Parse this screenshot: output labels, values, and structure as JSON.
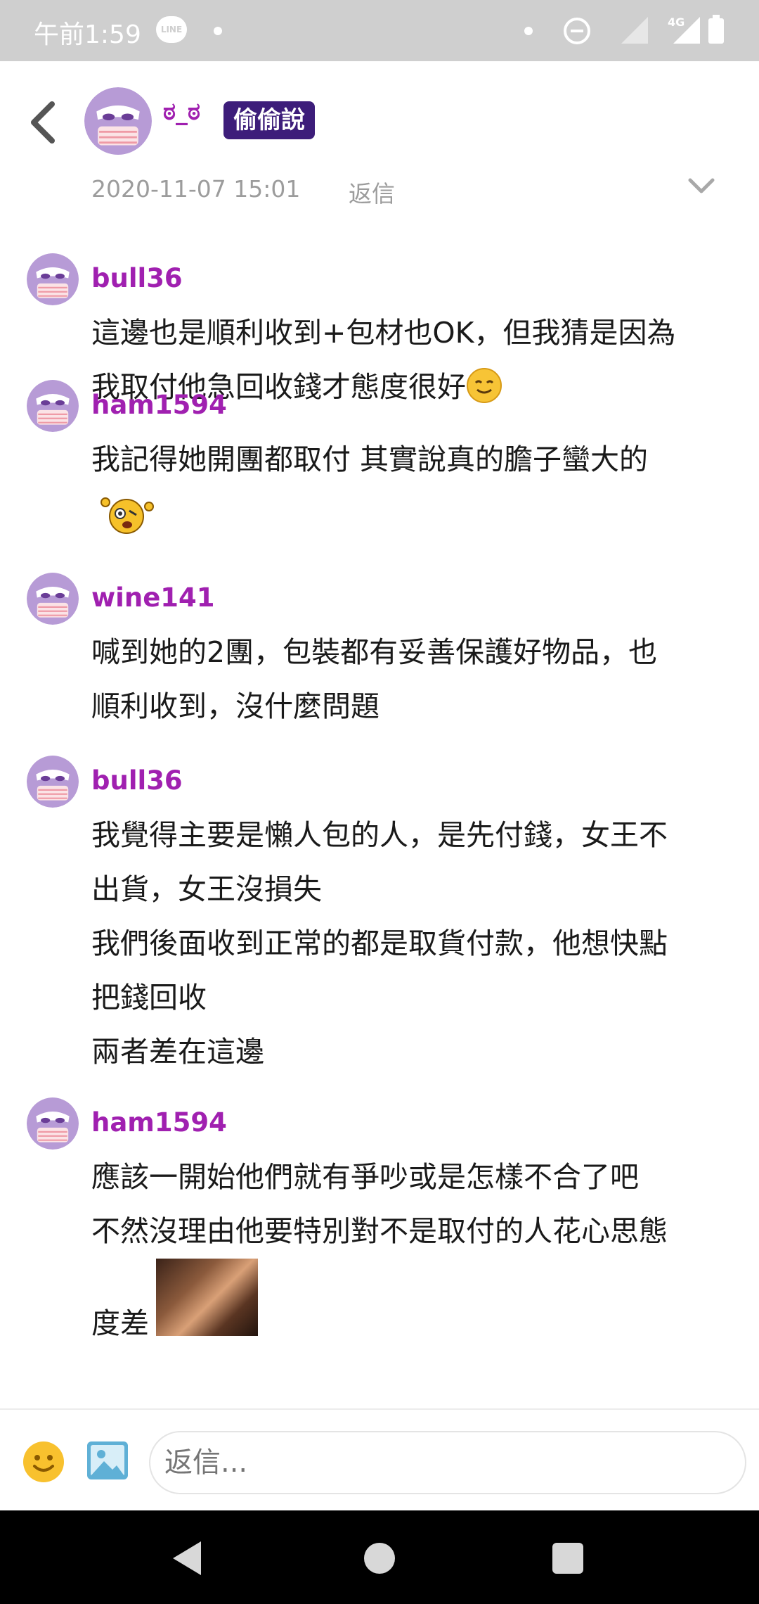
{
  "status_bar": {
    "time": "午前1:59",
    "line_badge": "LINE",
    "network": "4G"
  },
  "header": {
    "user_name": "ಠ_ಠ",
    "tag": "偷偷說",
    "date": "2020-11-07 15:01",
    "reply_label": "返信"
  },
  "comments": [
    {
      "user": "bull36",
      "line1": "這邊也是順利收到+包材也OK，但我猜是因為",
      "line2": "我取付他急回收錢才態度很好",
      "emoji": "smile-emoji"
    },
    {
      "user": "ham1594",
      "text": "我記得她開團都取付 其實說真的膽子蠻大的",
      "sticker": "dizzy-face-sticker"
    },
    {
      "user": "wine141",
      "text": "喊到她的2團，包裝都有妥善保護好物品，也\n順利收到，沒什麼問題"
    },
    {
      "user": "bull36",
      "text": "我覺得主要是懶人包的人，是先付錢，女王不\n出貨，女王沒損失\n我們後面收到正常的都是取貨付款，他想快點\n把錢回收\n兩者差在這邊"
    },
    {
      "user": "ham1594",
      "text": "應該一開始他們就有爭吵或是怎樣不合了吧\n不然沒理由他要特別對不是取付的人花心思態",
      "tail": "度差",
      "gif": "facepalm-gif"
    }
  ],
  "input_bar": {
    "placeholder": "返信..."
  },
  "colors": {
    "username": "#a020b0",
    "tag_bg": "#3d1d7a",
    "meta_text": "#9c9c9c",
    "status_bar_bg": "#cfcfcf"
  }
}
